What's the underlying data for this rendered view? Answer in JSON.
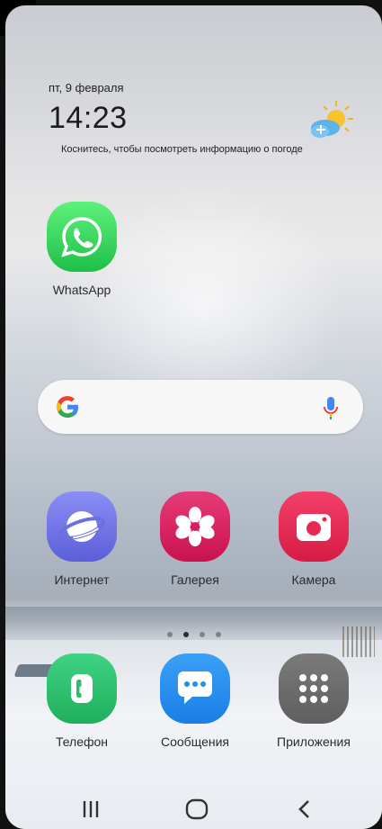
{
  "status": {
    "date": "пт, 9 февраля",
    "time": "14:23",
    "weather_hint": "Коснитесь, чтобы посмотреть информацию о погоде",
    "weather_icon": "partly-cloudy-sun-icon"
  },
  "apps": {
    "whatsapp": {
      "label": "WhatsApp",
      "icon": "whatsapp-icon",
      "color": "#25D366"
    },
    "internet": {
      "label": "Интернет",
      "icon": "planet-icon",
      "color": "#6B6FE0"
    },
    "gallery": {
      "label": "Галерея",
      "icon": "flower-icon",
      "color": "#D61F62"
    },
    "camera": {
      "label": "Камера",
      "icon": "camera-icon",
      "color": "#E8284F"
    },
    "phone": {
      "label": "Телефон",
      "icon": "phone-icon",
      "color": "#2DBD6E"
    },
    "messages": {
      "label": "Сообщения",
      "icon": "chat-bubble-icon",
      "color": "#1F8EF1"
    },
    "apps_drawer": {
      "label": "Приложения",
      "icon": "grid-icon",
      "color": "#6C6C6C"
    }
  },
  "search": {
    "icon": "google-g-icon",
    "mic_icon": "mic-icon"
  },
  "pages": {
    "count": 4,
    "active": 2
  },
  "nav": {
    "recents": "recents-icon",
    "home": "home-icon",
    "back": "back-icon"
  }
}
